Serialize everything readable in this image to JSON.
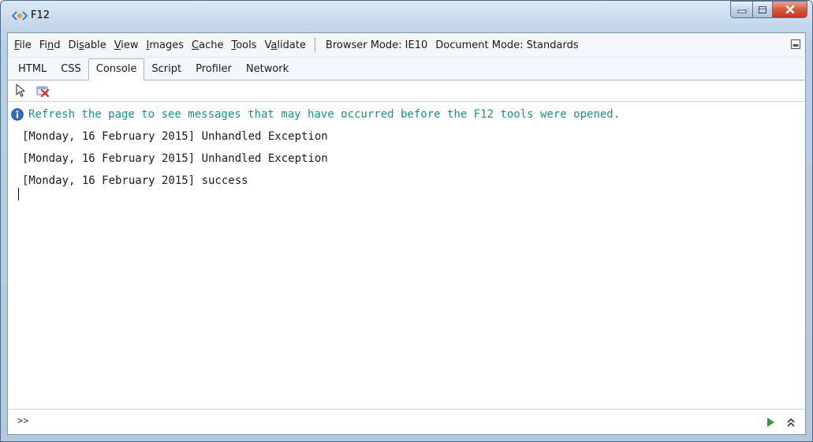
{
  "window": {
    "title": "F12",
    "icon": "f12-devtools-icon",
    "controls": {
      "minimize": "minimize-icon",
      "maximize": "maximize-icon",
      "close": "close-icon"
    }
  },
  "menu": {
    "items": [
      "File",
      "Find",
      "Disable",
      "View",
      "Images",
      "Cache",
      "Tools",
      "Validate"
    ],
    "browser_mode": "Browser Mode: IE10",
    "document_mode": "Document Mode: Standards"
  },
  "tabs": {
    "items": [
      "HTML",
      "CSS",
      "Console",
      "Script",
      "Profiler",
      "Network"
    ],
    "active": "Console"
  },
  "toolbar": {
    "select_tool": "pointer-select-icon",
    "clear_tool": "clear-console-icon"
  },
  "console": {
    "info_message": "Refresh the page to see messages that may have occurred before the F12 tools were opened.",
    "lines": [
      "[Monday, 16 February 2015] Unhandled Exception",
      "[Monday, 16 February 2015] Unhandled Exception",
      "[Monday, 16 February 2015] success"
    ]
  },
  "input": {
    "prompt": ">>",
    "run_icon": "run-script-icon",
    "expand_icon": "expand-multiline-icon"
  },
  "colors": {
    "info_text": "#1f8f86",
    "chrome_blue": "#c5d8ec",
    "close_red": "#c23a1e"
  }
}
